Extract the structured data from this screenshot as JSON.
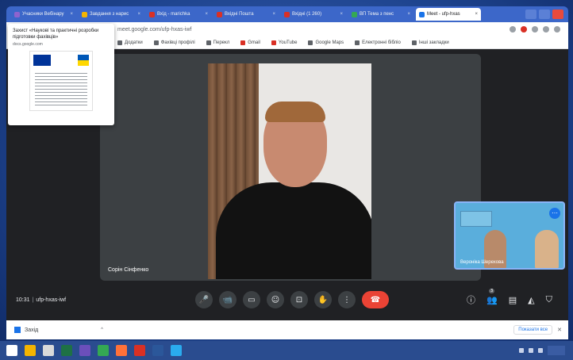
{
  "browser": {
    "tabs": [
      {
        "label": "Учасники Вебінару",
        "color": "#8e63ce"
      },
      {
        "label": "Завдання з нарис",
        "color": "#f4b400"
      },
      {
        "label": "Вхід - marichka",
        "color": "#d93025"
      },
      {
        "label": "Вхідні Пошта",
        "color": "#d93025"
      },
      {
        "label": "Вхідні (1 260)",
        "color": "#d93025"
      },
      {
        "label": "ВП Тема з пенс",
        "color": "#34a853"
      },
      {
        "label": "Meet - ufp-hxas",
        "color": "#1a73e8",
        "active": true
      }
    ],
    "url": "meet.google.com/ufp-hxas-iwf",
    "bookmarks": [
      {
        "label": "Додатки",
        "red": false
      },
      {
        "label": "Фахівці профілі",
        "red": false
      },
      {
        "label": "Перекл",
        "red": false
      },
      {
        "label": "Gmail",
        "red": true
      },
      {
        "label": "YouTube",
        "red": true
      },
      {
        "label": "Google Maps",
        "red": false
      },
      {
        "label": "Електронні бібліо",
        "red": false
      },
      {
        "label": "Інші закладки",
        "red": false
      }
    ]
  },
  "notification": {
    "title": "Захист «Наукові та практичні розробки підготовки фахівців»",
    "site": "docs.google.com"
  },
  "meet": {
    "main_participant": "Сорін Сінфенко",
    "self_participant": "Вероніка Шерехова",
    "meeting_time": "10:31",
    "meeting_code": "ufp-hxas-iwf",
    "participants_badge": "3",
    "controls": {
      "mic": "🎤",
      "camera": "📹",
      "captions": "▭",
      "emoji": "☺",
      "present": "⊡",
      "raise_hand": "✋",
      "more": "⋮",
      "end_call": "☎"
    }
  },
  "downloads": {
    "file_name": "Захід",
    "show_all": "Показати все",
    "close": "✕"
  },
  "taskbar": {
    "icons": [
      {
        "name": "start-icon",
        "color": "#ffffff"
      },
      {
        "name": "file-explorer-icon",
        "color": "#f4b400"
      },
      {
        "name": "media-icon",
        "color": "#d9d9d9"
      },
      {
        "name": "excel-icon",
        "color": "#1e7145"
      },
      {
        "name": "store-icon",
        "color": "#6b4fbb"
      },
      {
        "name": "chrome-icon",
        "color": "#34a853"
      },
      {
        "name": "firefox-icon",
        "color": "#ff7139"
      },
      {
        "name": "acrobat-icon",
        "color": "#d93025"
      },
      {
        "name": "word-icon",
        "color": "#2b579a"
      },
      {
        "name": "telegram-icon",
        "color": "#2aabee"
      }
    ]
  }
}
